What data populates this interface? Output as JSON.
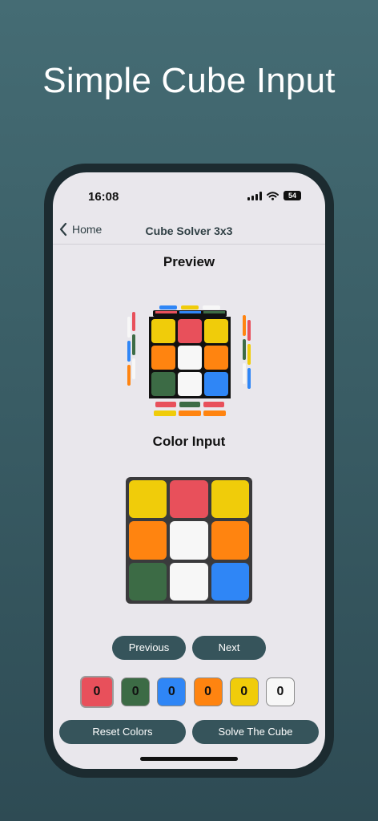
{
  "headline": "Simple Cube Input",
  "status": {
    "time": "16:08",
    "battery": "54"
  },
  "nav": {
    "back_label": "Home",
    "title": "Cube Solver 3x3"
  },
  "preview": {
    "title": "Preview"
  },
  "color_input": {
    "title": "Color Input",
    "cells": [
      "yellow",
      "red",
      "yellow",
      "orange",
      "white",
      "orange",
      "green",
      "white",
      "blue"
    ]
  },
  "buttons": {
    "previous": "Previous",
    "next": "Next",
    "reset": "Reset Colors",
    "solve": "Solve The Cube"
  },
  "palette": [
    {
      "color": "red",
      "hex": "#e8505b",
      "count": "0",
      "selected": true
    },
    {
      "color": "green",
      "hex": "#3c6b45",
      "count": "0"
    },
    {
      "color": "blue",
      "hex": "#2f86f6",
      "count": "0"
    },
    {
      "color": "orange",
      "hex": "#ff8410",
      "count": "0"
    },
    {
      "color": "yellow",
      "hex": "#f0cc0a",
      "count": "0"
    },
    {
      "color": "white",
      "hex": "#f7f7f7",
      "count": "0"
    }
  ],
  "colors": {
    "yellow": "#f0cc0a",
    "red": "#e8505b",
    "orange": "#ff8410",
    "white": "#f7f7f7",
    "green": "#3c6b45",
    "blue": "#2f86f6",
    "accent": "#36545b"
  }
}
